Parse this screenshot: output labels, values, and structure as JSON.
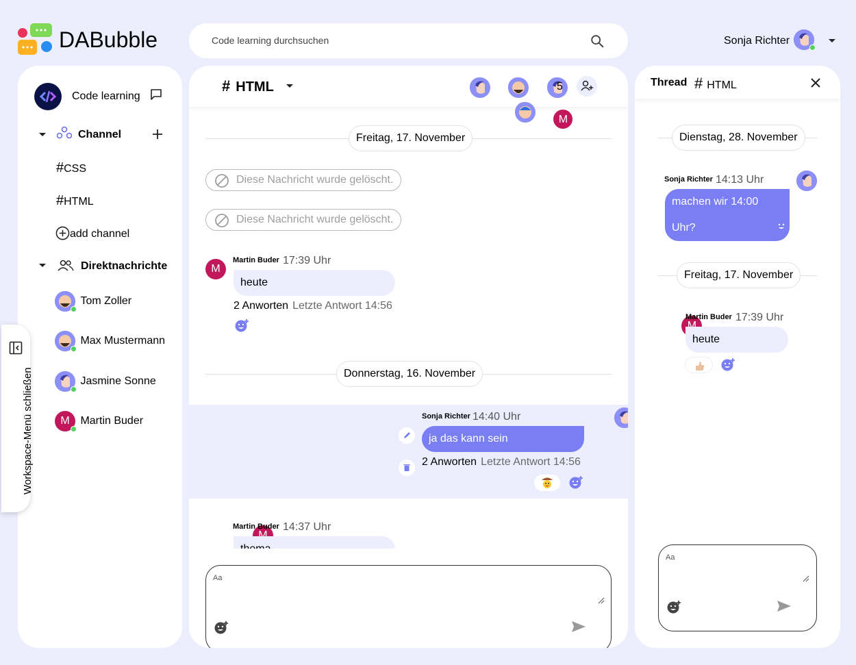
{
  "app": {
    "name": "DABubble"
  },
  "search": {
    "placeholder": "Code learning durchsuchen"
  },
  "user": {
    "name": "Sonja Richter"
  },
  "workspace": {
    "name": "Code learning"
  },
  "sidebar": {
    "channel_header": "Channel",
    "channels": [
      {
        "label": "CSS"
      },
      {
        "label": "HTML"
      }
    ],
    "add_channel": "add channel",
    "dm_header": "Direktnachrichten",
    "dms": [
      {
        "name": "Tom Zoller"
      },
      {
        "name": "Max Mustermann"
      },
      {
        "name": "Jasmine Sonne"
      },
      {
        "name": "Martin Buder",
        "initial": "M"
      }
    ]
  },
  "workspace_toggle": {
    "label": "Workspace-Menü schließen"
  },
  "channel": {
    "name": "HTML",
    "member_count": "5",
    "member_initial": "M",
    "date1": "Freitag, 17. November",
    "deleted1": "Diese Nachricht wurde gelöscht.",
    "deleted2": "Diese Nachricht wurde gelöscht.",
    "msg1": {
      "author": "Martin Buder",
      "initial": "M",
      "time": "17:39 Uhr",
      "text": "heute",
      "answers": "2 Anworten",
      "last": "Letzte Antwort 14:56"
    },
    "date2": "Donnerstag, 16. November",
    "msg2": {
      "author": "Sonja Richter",
      "time": "14:40 Uhr",
      "text": "ja das kann sein",
      "answers": "2 Anworten",
      "last": "Letzte Antwort 14:56"
    },
    "msg3": {
      "author": "Martin Buder",
      "initial": "M",
      "time": "14:37 Uhr",
      "text": "thema"
    },
    "input_placeholder": "Aa"
  },
  "thread": {
    "title": "Thread",
    "channel": "HTML",
    "date1": "Dienstag, 28. November",
    "msg1": {
      "author": "Sonja Richter",
      "time": "14:13 Uhr",
      "text": "machen wir 14:00 Uhr?"
    },
    "date2": "Freitag, 17. November",
    "msg2": {
      "author": "Martin Buder",
      "initial": "M",
      "time": "17:39 Uhr",
      "text": "heute"
    },
    "input_placeholder": "Aa"
  },
  "colors": {
    "accent": "#797ef3",
    "background": "#eceefe",
    "online": "#4fd35a",
    "avatar_m": "#c2185b"
  }
}
